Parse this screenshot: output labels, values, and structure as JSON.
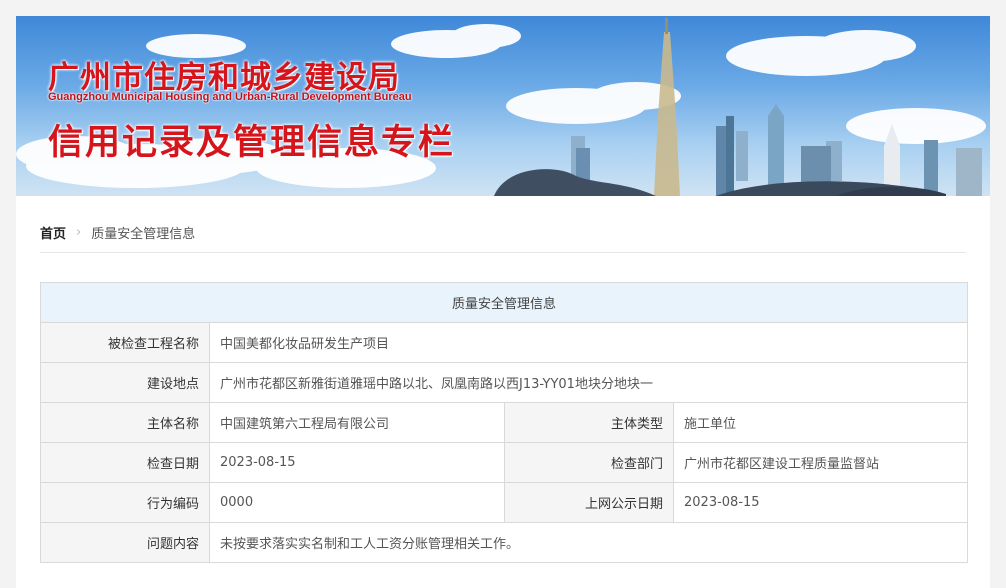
{
  "banner": {
    "title_cn": "广州市住房和城乡建设局",
    "title_en": "Guangzhou Municipal Housing and Urban-Rural Development Bureau",
    "subtitle": "信用记录及管理信息专栏"
  },
  "breadcrumb": {
    "home": "首页",
    "separator": "›",
    "current": "质量安全管理信息"
  },
  "table": {
    "header": "质量安全管理信息",
    "project_name_label": "被检查工程名称",
    "project_name": "中国美都化妆品研发生产项目",
    "location_label": "建设地点",
    "location": "广州市花都区新雅街道雅瑶中路以北、凤凰南路以西J13-YY01地块分地块一",
    "entity_name_label": "主体名称",
    "entity_name": "中国建筑第六工程局有限公司",
    "entity_type_label": "主体类型",
    "entity_type": "施工单位",
    "check_date_label": "检查日期",
    "check_date": "2023-08-15",
    "check_dept_label": "检查部门",
    "check_dept": "广州市花都区建设工程质量监督站",
    "behavior_code_label": "行为编码",
    "behavior_code": "0000",
    "publish_date_label": "上网公示日期",
    "publish_date": "2023-08-15",
    "issue_label": "问题内容",
    "issue": "未按要求落实实名制和工人工资分账管理相关工作。"
  },
  "colors": {
    "title_red": "#d6141b",
    "page_bg": "#f3f3f3",
    "table_header_bg": "#e8f3fb",
    "label_bg": "#f5f5f5",
    "border": "#d9d9d9"
  }
}
